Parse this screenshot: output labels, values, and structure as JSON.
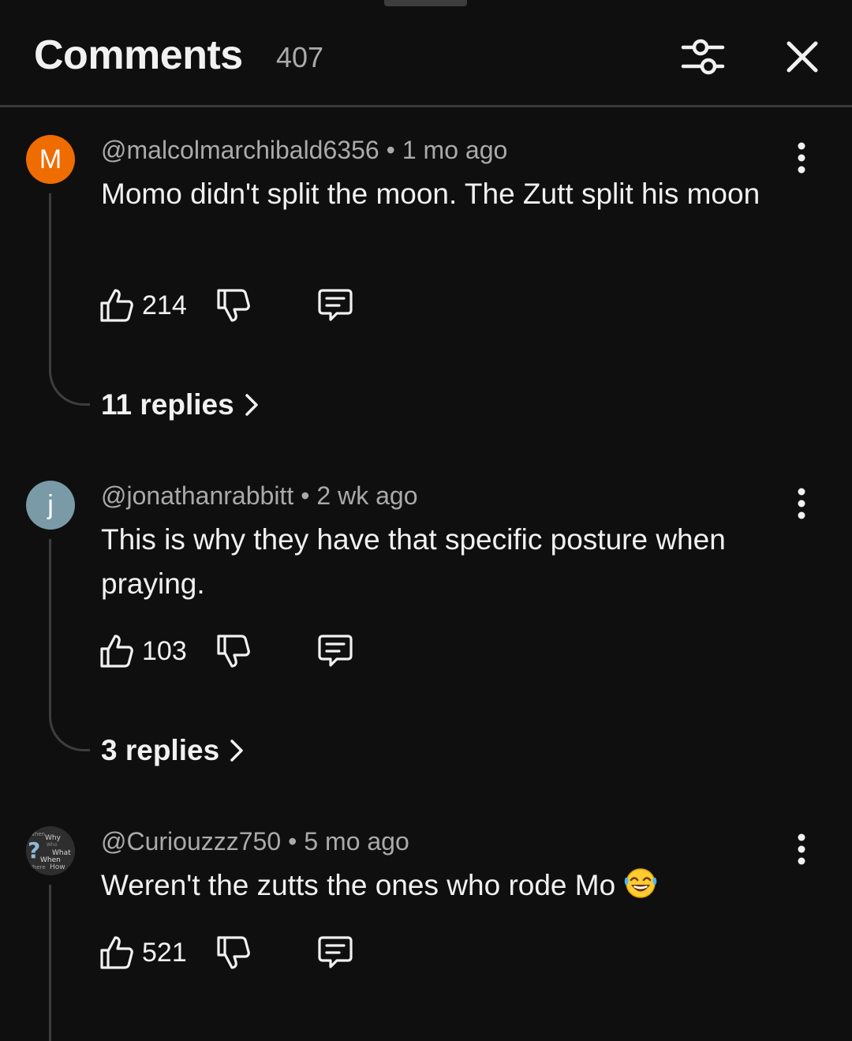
{
  "header": {
    "title": "Comments",
    "count": "407"
  },
  "comments": [
    {
      "avatar_letter": "M",
      "avatar_color": "#ef6c00",
      "handle": "@malcolmarchibald6356",
      "separator": "•",
      "time": "1 mo ago",
      "text": "Momo didn't split the moon. The Zutt split his moon",
      "likes": "214",
      "replies": "11 replies"
    },
    {
      "avatar_letter": "j",
      "avatar_color": "#7a9aa8",
      "handle": "@jonathanrabbitt",
      "separator": "•",
      "time": "2 wk ago",
      "text": "This is why they have that specific posture when praying.",
      "likes": "103",
      "replies": "3 replies"
    },
    {
      "avatar_words": [
        "When",
        "Why",
        "Who",
        "What",
        "When",
        "Where",
        "How",
        "?"
      ],
      "handle": "@Curiouzzz750",
      "separator": "•",
      "time": "5 mo ago",
      "text": "Weren't the zutts the ones who rode Mo",
      "emoji": "laughing-tears-emoji",
      "likes": "521"
    }
  ],
  "icons": {
    "filter": "sliders-icon",
    "close": "close-icon",
    "more": "more-vert-icon",
    "like": "thumb-up-icon",
    "dislike": "thumb-down-icon",
    "reply": "comment-reply-icon",
    "chevron": "chevron-right-icon"
  }
}
